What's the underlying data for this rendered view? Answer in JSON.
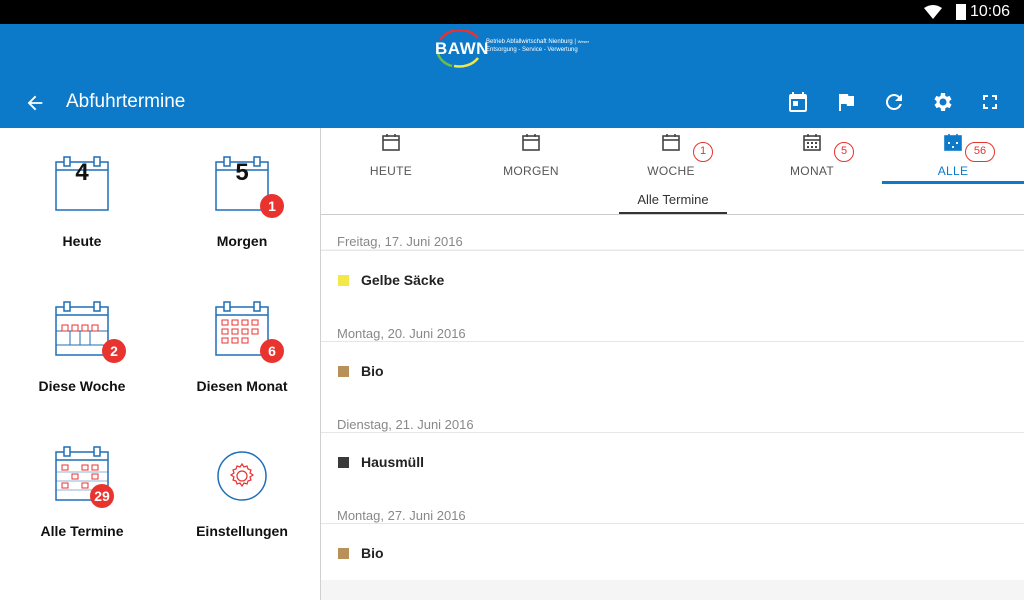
{
  "status": {
    "time": "10:06"
  },
  "app": {
    "logo_word": "BAWN",
    "logo_line1": "Betrieb Abfallwirtschaft Nienburg",
    "logo_line1_suffix": "Weser",
    "logo_line2": "Entsorgung - Service - Verwertung",
    "title": "Abfuhrtermine"
  },
  "toolbar_icons": [
    "calendar-today-icon",
    "flag-icon",
    "refresh-icon",
    "settings-icon",
    "fullscreen-icon"
  ],
  "tiles": [
    {
      "label": "Heute",
      "day": "4",
      "badge": ""
    },
    {
      "label": "Morgen",
      "day": "5",
      "badge": "1"
    },
    {
      "label": "Diese Woche",
      "badge": "2"
    },
    {
      "label": "Diesen Monat",
      "badge": "6"
    },
    {
      "label": "Alle Termine",
      "badge": "29"
    },
    {
      "label": "Einstellungen",
      "badge": ""
    }
  ],
  "tabs": [
    {
      "label": "HEUTE",
      "badge": ""
    },
    {
      "label": "MORGEN",
      "badge": ""
    },
    {
      "label": "WOCHE",
      "badge": "1"
    },
    {
      "label": "MONAT",
      "badge": "5"
    },
    {
      "label": "ALLE",
      "badge": "56"
    }
  ],
  "subtab": "Alle Termine",
  "groups": [
    {
      "date": "Freitag, 17. Juni 2016",
      "item": "Gelbe Säcke",
      "color": "#f3e84a"
    },
    {
      "date": "Montag, 20. Juni 2016",
      "item": "Bio",
      "color": "#b8915a"
    },
    {
      "date": "Dienstag, 21. Juni 2016",
      "item": "Hausmüll",
      "color": "#3a3a3a"
    },
    {
      "date": "Montag, 27. Juni 2016",
      "item": "Bio",
      "color": "#b8915a"
    }
  ],
  "colors": {
    "accent": "#0c7ac9",
    "badge": "#e8332f"
  }
}
